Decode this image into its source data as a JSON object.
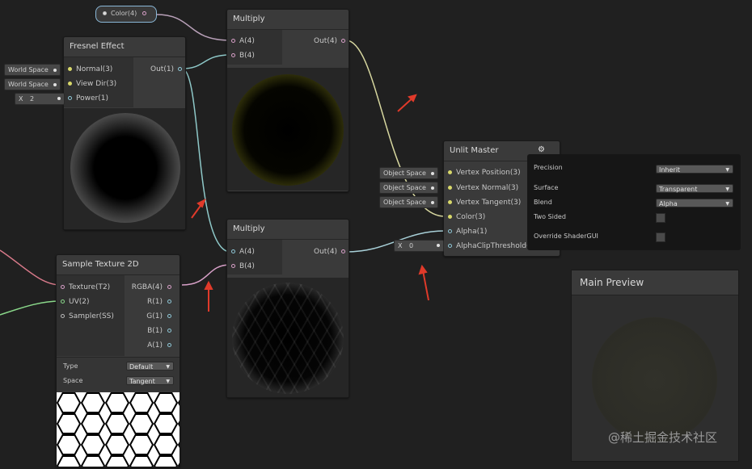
{
  "color_property": {
    "label": "Color(4)"
  },
  "fresnel_node": {
    "title": "Fresnel Effect",
    "inputs": [
      "Normal(3)",
      "View Dir(3)",
      "Power(1)"
    ],
    "output": "Out(1)",
    "chips": [
      "World Space",
      "World Space"
    ],
    "power_axis": "X",
    "power_value": "2"
  },
  "multiply_top": {
    "title": "Multiply",
    "inputs": [
      "A(4)",
      "B(4)"
    ],
    "output": "Out(4)"
  },
  "multiply_bottom": {
    "title": "Multiply",
    "inputs": [
      "A(4)",
      "B(4)"
    ],
    "output": "Out(4)"
  },
  "sample_texture": {
    "title": "Sample Texture 2D",
    "inputs": [
      "Texture(T2)",
      "UV(2)",
      "Sampler(SS)"
    ],
    "outputs": [
      "RGBA(4)",
      "R(1)",
      "G(1)",
      "B(1)",
      "A(1)"
    ],
    "type_label": "Type",
    "type_value": "Default",
    "space_label": "Space",
    "space_value": "Tangent"
  },
  "unlit_master": {
    "title": "Unlit Master",
    "inputs": [
      "Vertex Position(3)",
      "Vertex Normal(3)",
      "Vertex Tangent(3)",
      "Color(3)",
      "Alpha(1)",
      "AlphaClipThreshold(1)"
    ],
    "chips": [
      "Object Space",
      "Object Space",
      "Object Space"
    ],
    "alpha_clip_axis": "X",
    "alpha_clip_value": "0"
  },
  "settings": {
    "rows": [
      {
        "label": "Precision",
        "value": "Inherit"
      },
      {
        "label": "Surface",
        "value": "Transparent"
      },
      {
        "label": "Blend",
        "value": "Alpha"
      },
      {
        "label": "Two Sided",
        "value": ""
      },
      {
        "label": "Override ShaderGUI",
        "value": ""
      }
    ]
  },
  "main_preview": {
    "title": "Main Preview"
  },
  "watermark": "@稀土掘金技术社区",
  "colors": {
    "background": "#202020",
    "node": "#3a3a3a",
    "annotation_arrow": "#e03a2a",
    "rim_yellow": "#d8d84a"
  }
}
